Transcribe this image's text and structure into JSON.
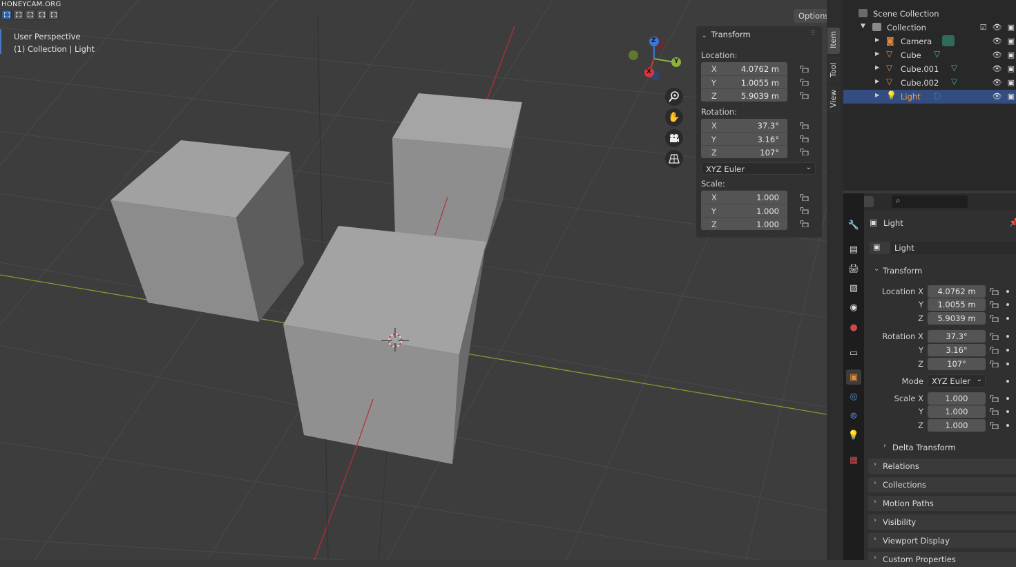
{
  "watermark": "HONEYCAM.ORG",
  "viewport": {
    "view_name": "User Perspective",
    "collection_info": "(1) Collection | Light",
    "options_label": "Options",
    "gizmo": {
      "x": "X",
      "y": "Y",
      "z": "Z"
    }
  },
  "npanel": {
    "title": "Transform",
    "location_label": "Location:",
    "rotation_label": "Rotation:",
    "scale_label": "Scale:",
    "location": [
      {
        "axis": "X",
        "value": "4.0762 m"
      },
      {
        "axis": "Y",
        "value": "1.0055 m"
      },
      {
        "axis": "Z",
        "value": "5.9039 m"
      }
    ],
    "rotation": [
      {
        "axis": "X",
        "value": "37.3°"
      },
      {
        "axis": "Y",
        "value": "3.16°"
      },
      {
        "axis": "Z",
        "value": "107°"
      }
    ],
    "rotation_mode": "XYZ Euler",
    "scale": [
      {
        "axis": "X",
        "value": "1.000"
      },
      {
        "axis": "Y",
        "value": "1.000"
      },
      {
        "axis": "Z",
        "value": "1.000"
      }
    ],
    "tabs": [
      "Item",
      "Tool",
      "View"
    ]
  },
  "outliner": {
    "scene_collection": "Scene Collection",
    "collection": "Collection",
    "items": [
      {
        "name": "Camera",
        "icon": "camera-icon"
      },
      {
        "name": "Cube",
        "icon": "mesh-icon"
      },
      {
        "name": "Cube.001",
        "icon": "mesh-icon"
      },
      {
        "name": "Cube.002",
        "icon": "mesh-icon"
      },
      {
        "name": "Light",
        "icon": "light-icon",
        "selected": true
      }
    ]
  },
  "properties": {
    "header_object": "Light",
    "object_name": "Light",
    "transform_title": "Transform",
    "location_x_label": "Location X",
    "rotation_x_label": "Rotation X",
    "scale_x_label": "Scale X",
    "y_label": "Y",
    "z_label": "Z",
    "mode_label": "Mode",
    "location": [
      "4.0762 m",
      "1.0055 m",
      "5.9039 m"
    ],
    "rotation": [
      "37.3°",
      "3.16°",
      "107°"
    ],
    "mode": "XYZ Euler",
    "scale": [
      "1.000",
      "1.000",
      "1.000"
    ],
    "delta_transform": "Delta Transform",
    "sections": [
      "Relations",
      "Collections",
      "Motion Paths",
      "Visibility",
      "Viewport Display",
      "Custom Properties"
    ]
  },
  "colors": {
    "accent": "#4a78c2",
    "selected_row": "#334d80",
    "x_axis": "#d8343c",
    "y_axis": "#8fb23a",
    "z_axis": "#3b78d4"
  }
}
